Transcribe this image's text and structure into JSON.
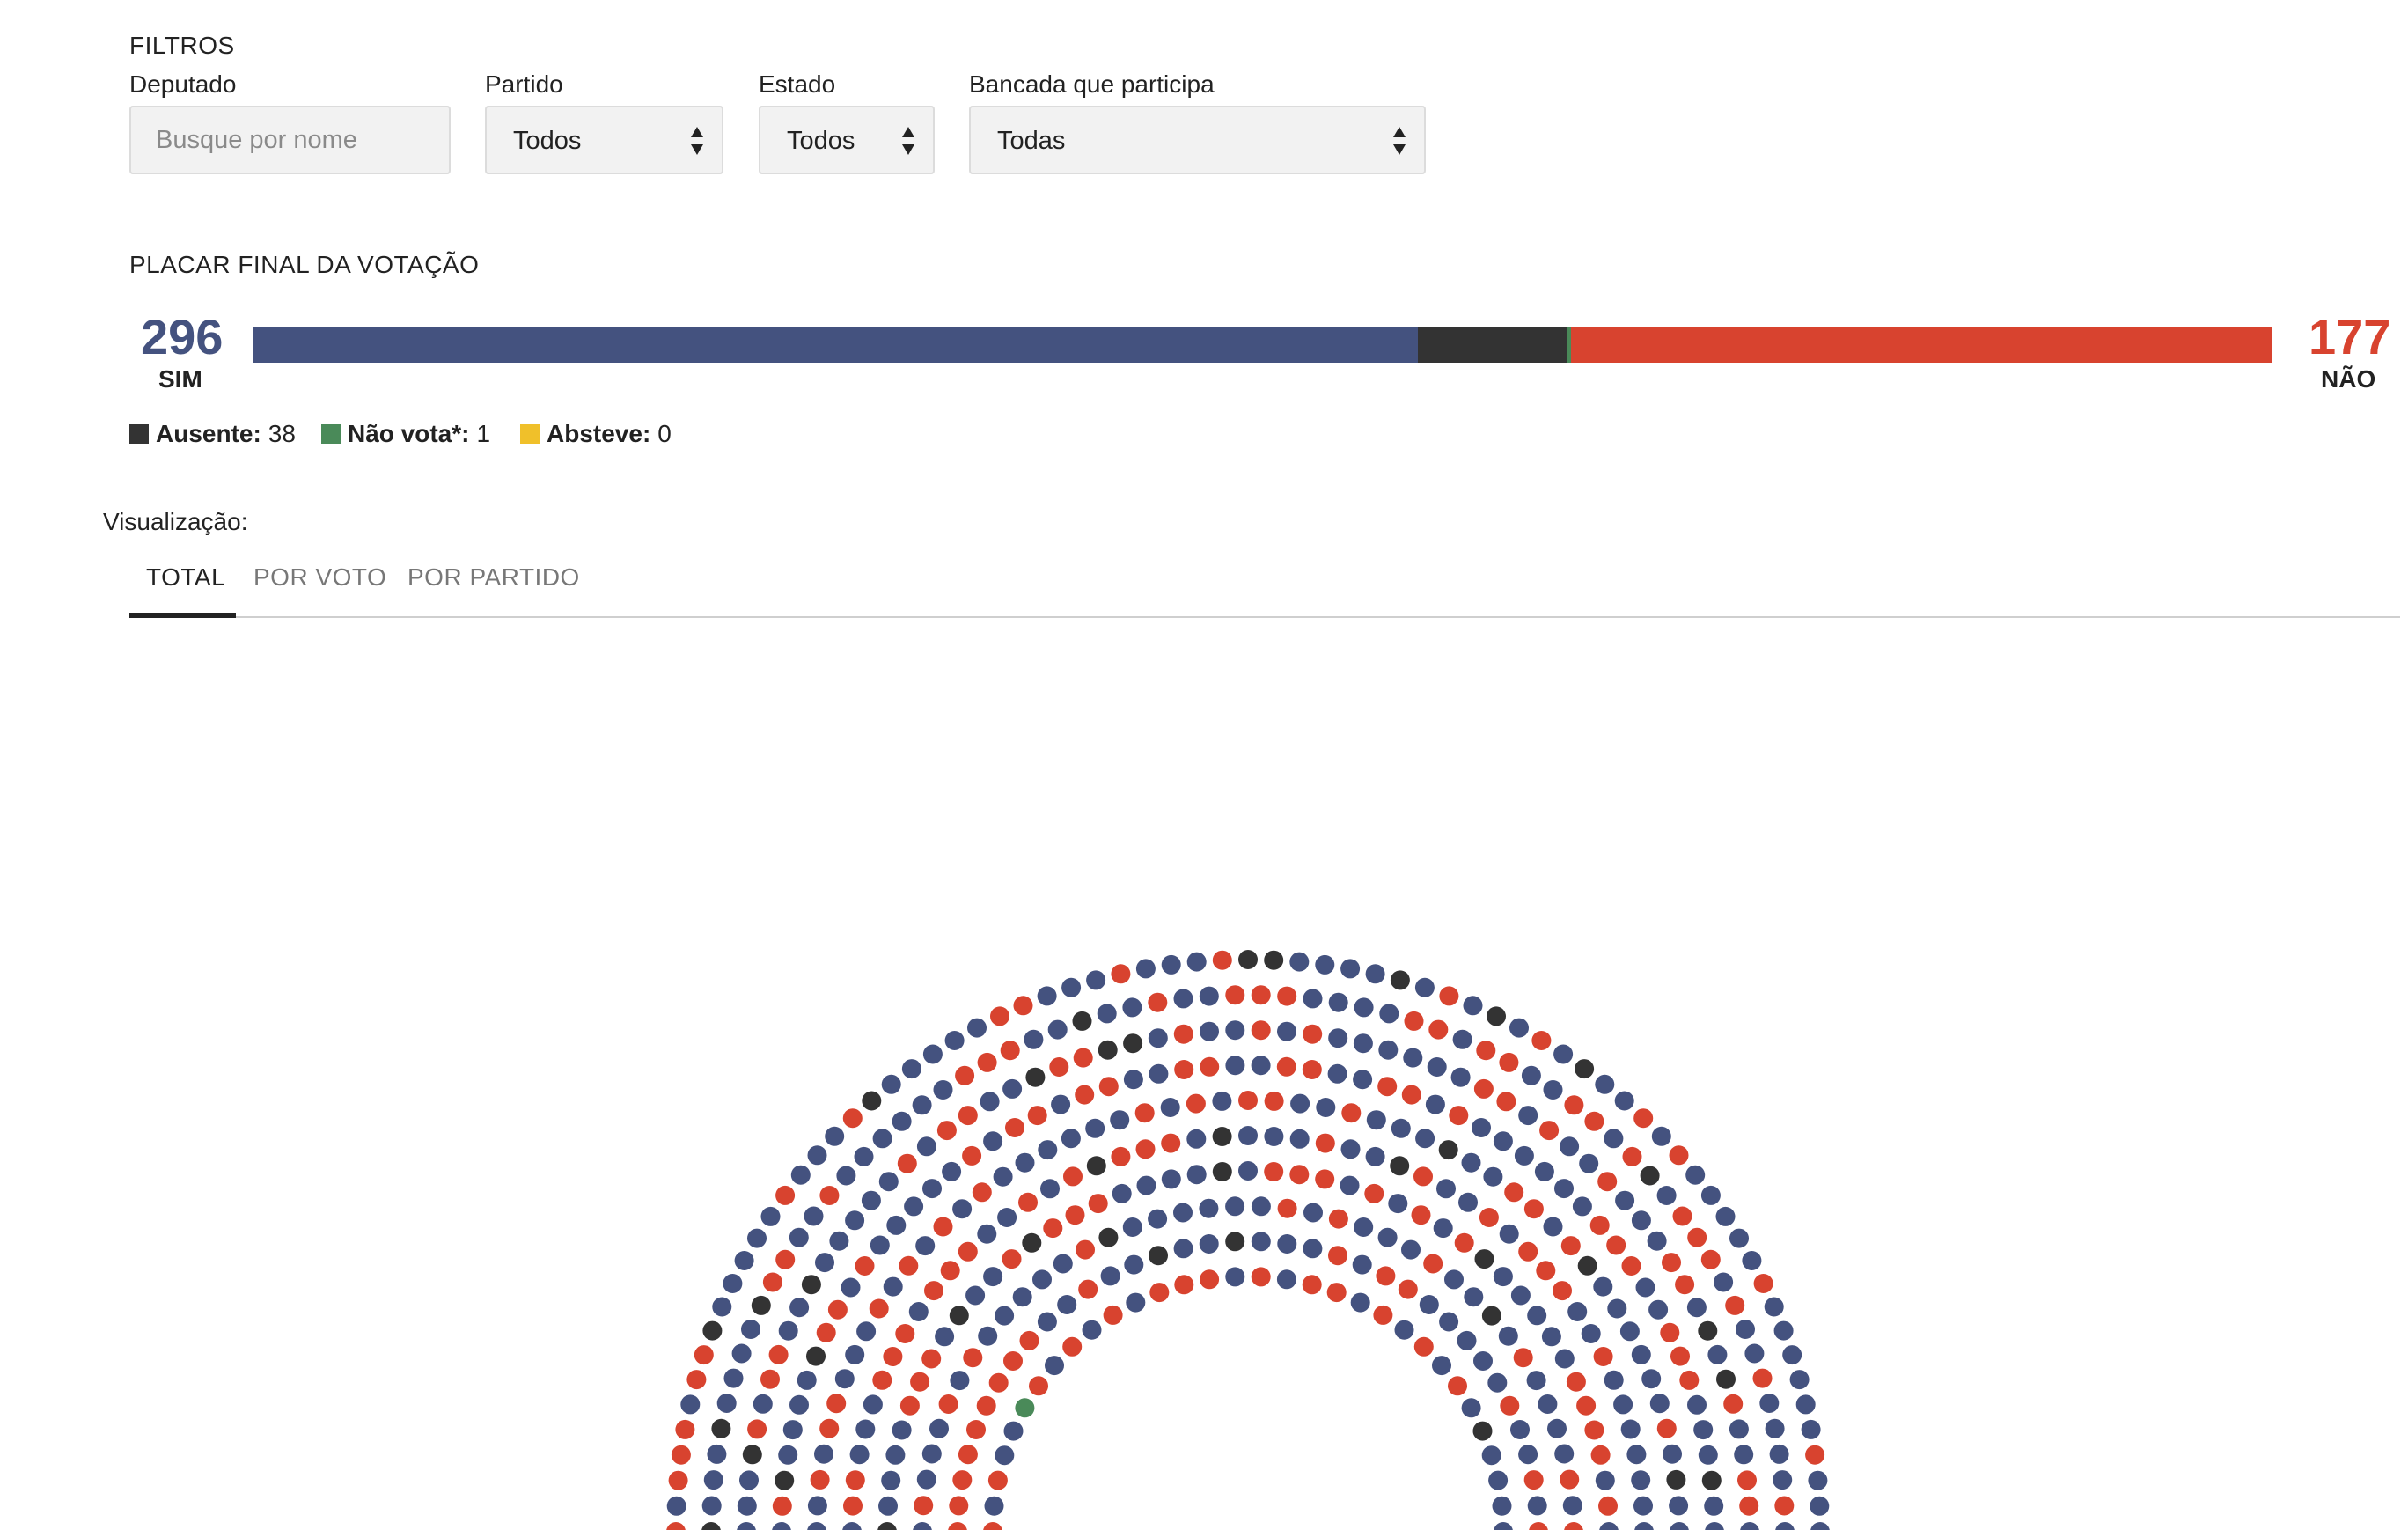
{
  "filters": {
    "title": "FILTROS",
    "deputado": {
      "label": "Deputado",
      "placeholder": "Busque por nome"
    },
    "partido": {
      "label": "Partido",
      "value": "Todos"
    },
    "estado": {
      "label": "Estado",
      "value": "Todos"
    },
    "bancada": {
      "label": "Bancada que participa",
      "value": "Todas"
    }
  },
  "placar": {
    "title": "PLACAR FINAL DA VOTAÇÃO",
    "sim": {
      "count": "296",
      "label": "SIM"
    },
    "nao": {
      "count": "177",
      "label": "NÃO"
    },
    "bar_fractions": {
      "sim": 0.577,
      "ausente": 0.074,
      "nao_vota": 0.002,
      "nao": 0.347
    },
    "legend": [
      {
        "label": "Ausente:",
        "value": "38",
        "color": "#333333"
      },
      {
        "label": "Não vota*:",
        "value": "1",
        "color": "#4a8a59"
      },
      {
        "label": "Absteve:",
        "value": "0",
        "color": "#f0c02a"
      }
    ]
  },
  "visualizacao": {
    "label": "Visualização:",
    "tabs": [
      {
        "label": "TOTAL",
        "active": true
      },
      {
        "label": "POR VOTO",
        "active": false
      },
      {
        "label": "POR PARTIDO",
        "active": false
      }
    ]
  },
  "colors": {
    "sim": "#44527f",
    "nao": "#d8432f",
    "ausente": "#333333",
    "nao_vota": "#4a8a59"
  },
  "seats": {
    "sim": 296,
    "nao": 177,
    "ausente": 38,
    "nao_vota": 1
  }
}
